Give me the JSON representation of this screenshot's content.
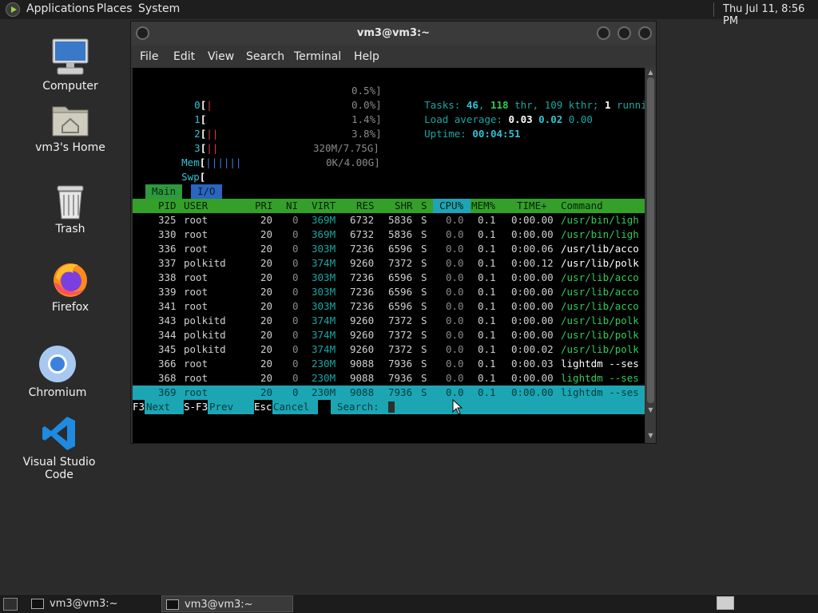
{
  "top_panel": {
    "menus": [
      "Applications",
      "Places",
      "System"
    ],
    "clock": "Thu Jul 11,  8:56 PM"
  },
  "desktop_icons": [
    {
      "label": "Computer",
      "icon": "computer-icon"
    },
    {
      "label": "vm3's Home",
      "icon": "home-folder-icon"
    },
    {
      "label": "Trash",
      "icon": "trash-icon"
    },
    {
      "label": "Firefox",
      "icon": "firefox-icon"
    },
    {
      "label": "Chromium",
      "icon": "chromium-icon"
    },
    {
      "label": "Visual Studio Code",
      "icon": "vscode-icon"
    }
  ],
  "window": {
    "title": "vm3@vm3:~",
    "menu": [
      "File",
      "Edit",
      "View",
      "Search",
      "Terminal",
      "Help"
    ]
  },
  "htop": {
    "cpus": [
      {
        "id": "0",
        "bars": "|",
        "pct": "0.5%]"
      },
      {
        "id": "1",
        "bars": "",
        "pct": "0.0%]"
      },
      {
        "id": "2",
        "bars": "||",
        "pct": "1.4%]"
      },
      {
        "id": "3",
        "bars": "||",
        "pct": "3.8%]"
      }
    ],
    "mem": {
      "label": "Mem",
      "bars": "||||||",
      "value": "320M/7.75G]"
    },
    "swp": {
      "label": "Swp",
      "bars": "",
      "value": "0K/4.00G]"
    },
    "tasks_label": "Tasks: ",
    "tasks_count": "46",
    "tasks_sep": ", ",
    "tasks_thr": "118",
    "tasks_thr_label": " thr, 109 kthr; ",
    "tasks_running": "1",
    "tasks_running_label": " runnin",
    "load_label": "Load average: ",
    "load_1": "0.03",
    "load_5": "0.02",
    "load_15": "0.00",
    "uptime_label": "Uptime: ",
    "uptime": "00:04:51",
    "tabs": [
      "Main",
      "I/O"
    ],
    "columns": [
      "PID",
      "USER",
      "PRI",
      "NI",
      "VIRT",
      "RES",
      "SHR",
      "S",
      "CPU%",
      "MEM%",
      "TIME+",
      "Command"
    ],
    "rows": [
      {
        "pid": "325",
        "user": "root",
        "pri": "20",
        "ni": "0",
        "virt": "369M",
        "res": "6732",
        "shr": "5836",
        "s": "S",
        "cpu": "0.0",
        "mem": "0.1",
        "time": "0:00.00",
        "cmd": "/usr/bin/ligh",
        "cmd_style": "green"
      },
      {
        "pid": "330",
        "user": "root",
        "pri": "20",
        "ni": "0",
        "virt": "369M",
        "res": "6732",
        "shr": "5836",
        "s": "S",
        "cpu": "0.0",
        "mem": "0.1",
        "time": "0:00.00",
        "cmd": "/usr/bin/ligh",
        "cmd_style": "green"
      },
      {
        "pid": "336",
        "user": "root",
        "pri": "20",
        "ni": "0",
        "virt": "303M",
        "res": "7236",
        "shr": "6596",
        "s": "S",
        "cpu": "0.0",
        "mem": "0.1",
        "time": "0:00.06",
        "cmd": "/usr/lib/acco",
        "cmd_style": "white"
      },
      {
        "pid": "337",
        "user": "polkitd",
        "pri": "20",
        "ni": "0",
        "virt": "374M",
        "res": "9260",
        "shr": "7372",
        "s": "S",
        "cpu": "0.0",
        "mem": "0.1",
        "time": "0:00.12",
        "cmd": "/usr/lib/polk",
        "cmd_style": "white"
      },
      {
        "pid": "338",
        "user": "root",
        "pri": "20",
        "ni": "0",
        "virt": "303M",
        "res": "7236",
        "shr": "6596",
        "s": "S",
        "cpu": "0.0",
        "mem": "0.1",
        "time": "0:00.00",
        "cmd": "/usr/lib/acco",
        "cmd_style": "green"
      },
      {
        "pid": "339",
        "user": "root",
        "pri": "20",
        "ni": "0",
        "virt": "303M",
        "res": "7236",
        "shr": "6596",
        "s": "S",
        "cpu": "0.0",
        "mem": "0.1",
        "time": "0:00.00",
        "cmd": "/usr/lib/acco",
        "cmd_style": "green"
      },
      {
        "pid": "341",
        "user": "root",
        "pri": "20",
        "ni": "0",
        "virt": "303M",
        "res": "7236",
        "shr": "6596",
        "s": "S",
        "cpu": "0.0",
        "mem": "0.1",
        "time": "0:00.00",
        "cmd": "/usr/lib/acco",
        "cmd_style": "green"
      },
      {
        "pid": "343",
        "user": "polkitd",
        "pri": "20",
        "ni": "0",
        "virt": "374M",
        "res": "9260",
        "shr": "7372",
        "s": "S",
        "cpu": "0.0",
        "mem": "0.1",
        "time": "0:00.00",
        "cmd": "/usr/lib/polk",
        "cmd_style": "green"
      },
      {
        "pid": "344",
        "user": "polkitd",
        "pri": "20",
        "ni": "0",
        "virt": "374M",
        "res": "9260",
        "shr": "7372",
        "s": "S",
        "cpu": "0.0",
        "mem": "0.1",
        "time": "0:00.00",
        "cmd": "/usr/lib/polk",
        "cmd_style": "green"
      },
      {
        "pid": "345",
        "user": "polkitd",
        "pri": "20",
        "ni": "0",
        "virt": "374M",
        "res": "9260",
        "shr": "7372",
        "s": "S",
        "cpu": "0.0",
        "mem": "0.1",
        "time": "0:00.02",
        "cmd": "/usr/lib/polk",
        "cmd_style": "green"
      },
      {
        "pid": "366",
        "user": "root",
        "pri": "20",
        "ni": "0",
        "virt": "230M",
        "res": "9088",
        "shr": "7936",
        "s": "S",
        "cpu": "0.0",
        "mem": "0.1",
        "time": "0:00.03",
        "cmd": "lightdm --ses",
        "cmd_style": "white"
      },
      {
        "pid": "368",
        "user": "root",
        "pri": "20",
        "ni": "0",
        "virt": "230M",
        "res": "9088",
        "shr": "7936",
        "s": "S",
        "cpu": "0.0",
        "mem": "0.1",
        "time": "0:00.00",
        "cmd": "lightdm --ses",
        "cmd_style": "green"
      },
      {
        "pid": "369",
        "user": "root",
        "pri": "20",
        "ni": "0",
        "virt": "230M",
        "res": "9088",
        "shr": "7936",
        "s": "S",
        "cpu": "0.0",
        "mem": "0.1",
        "time": "0:00.00",
        "cmd": "lightdm --ses",
        "cmd_style": "selected"
      }
    ],
    "footer": {
      "f3_key": "F3",
      "f3_label": "Next",
      "sf3_key": "S-F3",
      "sf3_label": "Prev",
      "esc_key": "Esc",
      "esc_label": "Cancel",
      "search_label": "Search: ",
      "search_value": ""
    }
  },
  "taskbar": {
    "tasks": [
      "vm3@vm3:~",
      "vm3@vm3:~"
    ]
  }
}
